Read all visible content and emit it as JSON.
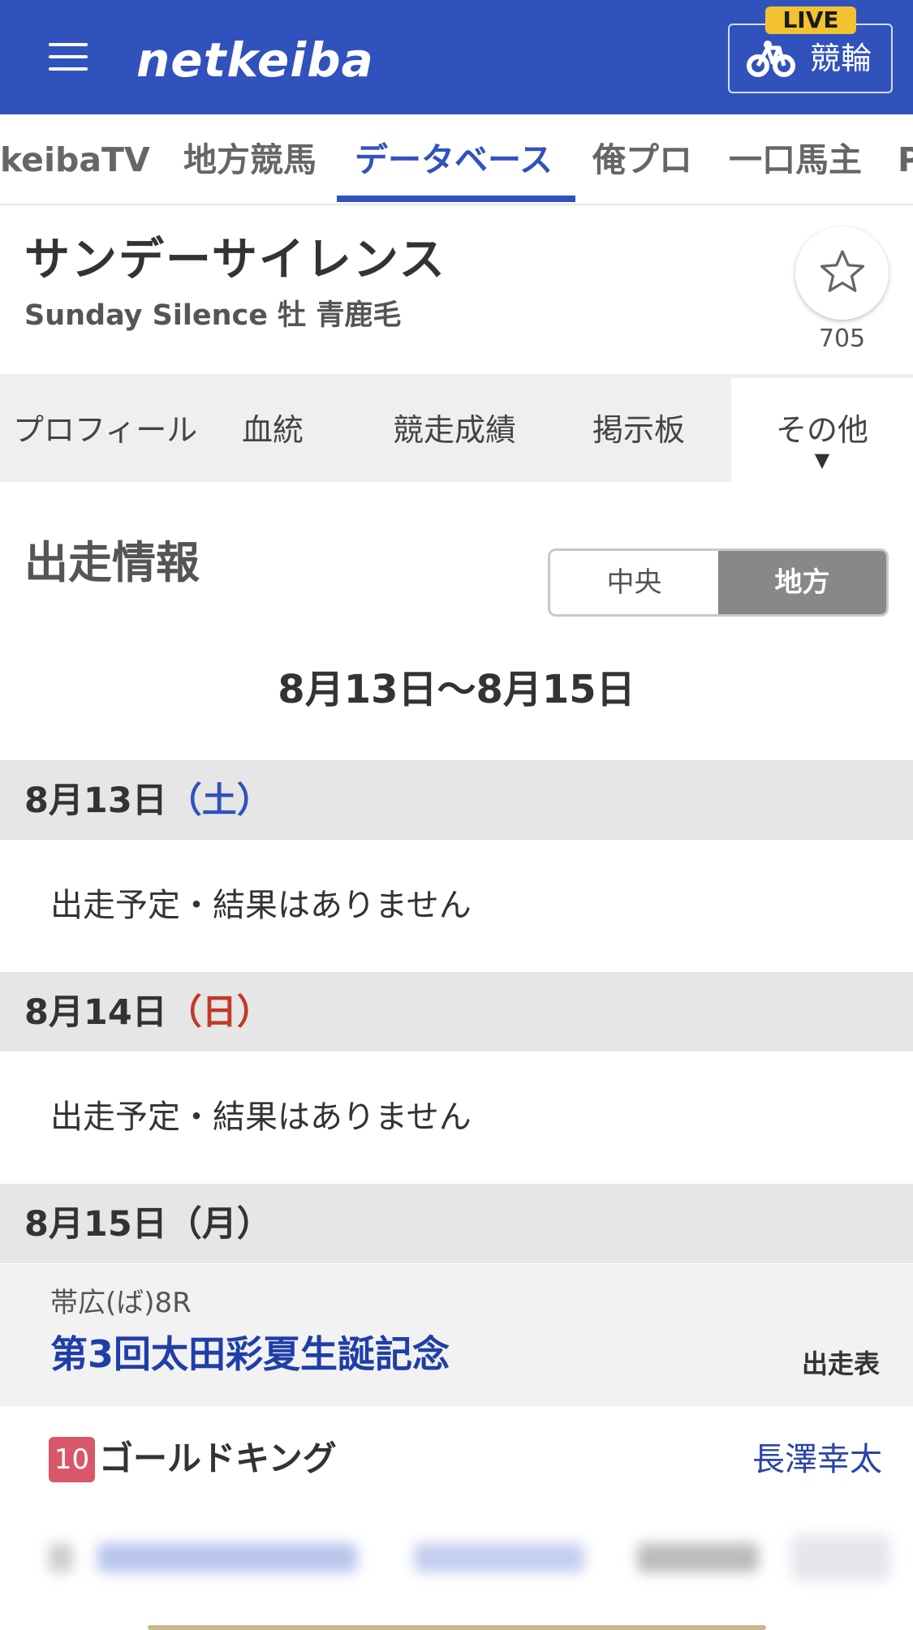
{
  "header": {
    "logo": "netkeiba",
    "live_badge": "LIVE",
    "live_label": "競輪"
  },
  "global_nav": {
    "items": [
      {
        "label": "keibaTV"
      },
      {
        "label": "地方競馬"
      },
      {
        "label": "データベース",
        "active": true
      },
      {
        "label": "俺プロ"
      },
      {
        "label": "一口馬主"
      },
      {
        "label": "P"
      }
    ]
  },
  "horse": {
    "name": "サンデーサイレンス",
    "subtitle": "Sunday Silence  牡  青鹿毛",
    "favorite_count": "705"
  },
  "sub_tabs": {
    "items": [
      {
        "label": "プロフィール"
      },
      {
        "label": "血統"
      },
      {
        "label": "競走成績"
      },
      {
        "label": "掲示板"
      }
    ],
    "more_label": "その他",
    "more_arrow": "▼"
  },
  "section": {
    "title": "出走情報",
    "toggle": {
      "left": "中央",
      "right": "地方",
      "selected": "地方"
    },
    "range": "8月13日〜8月15日"
  },
  "days": [
    {
      "date": "8月13日",
      "dow": "（土）",
      "message": "出走予定・結果はありません"
    },
    {
      "date": "8月14日",
      "dow": "（日）",
      "message": "出走予定・結果はありません"
    },
    {
      "date": "8月15日",
      "dow": "（月）"
    }
  ],
  "race": {
    "place": "帯広(ば)8R",
    "name": "第3回太田彩夏生誕記念",
    "card_link": "出走表",
    "entry": {
      "number": "10",
      "horse_name": "ゴールドキング",
      "jockey": "長澤幸太"
    }
  },
  "colors": {
    "brand_blue": "#3152bd",
    "live_yellow": "#f2c230",
    "saturday_blue": "#3152bd",
    "sunday_red": "#c0392b",
    "post_number_pink": "#d9576a"
  }
}
